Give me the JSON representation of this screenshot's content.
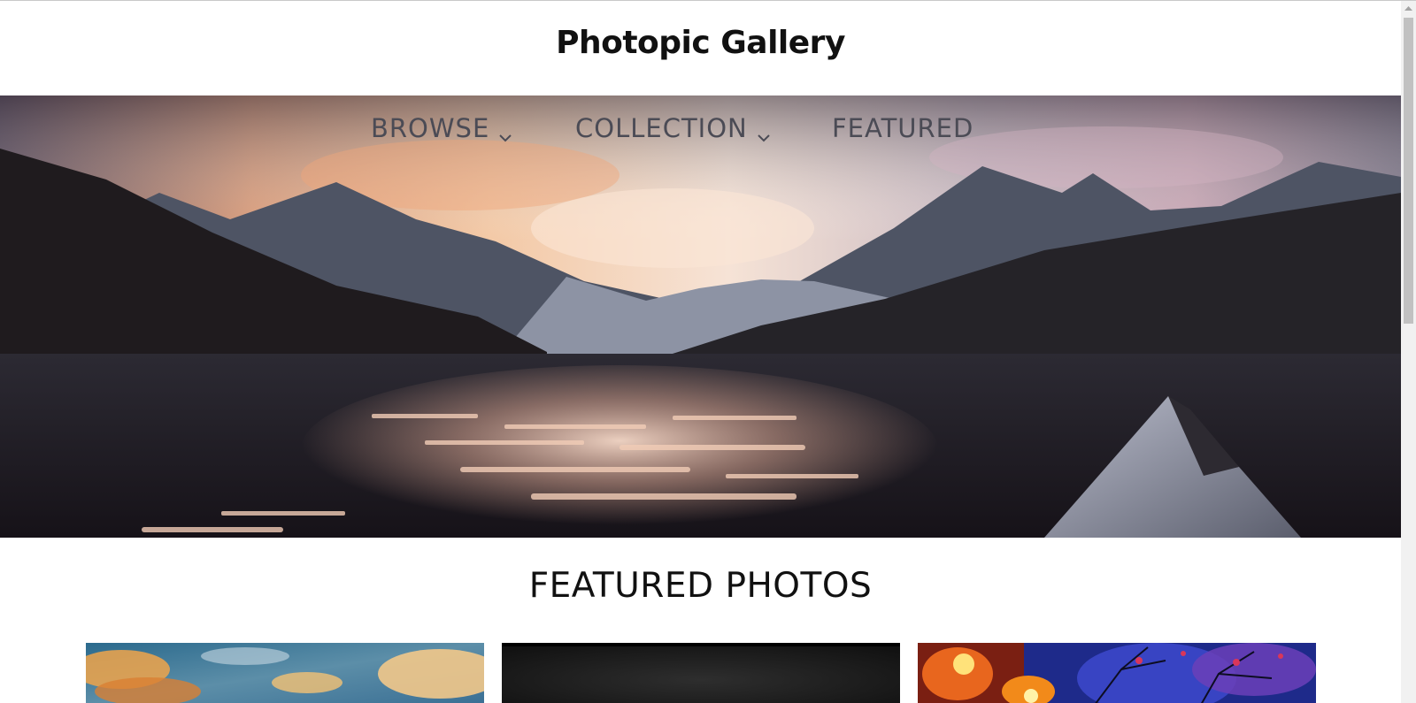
{
  "site": {
    "title": "Photopic Gallery"
  },
  "nav": {
    "items": [
      {
        "label": "BROWSE",
        "has_dropdown": true,
        "icon": "chevron-down-icon"
      },
      {
        "label": "COLLECTION",
        "has_dropdown": true,
        "icon": "chevron-down-icon"
      },
      {
        "label": "FEATURED",
        "has_dropdown": false
      }
    ]
  },
  "hero": {
    "image": "mountain-lake-sunset"
  },
  "featured": {
    "title": "FEATURED PHOTOS",
    "photos": [
      {
        "image": "sunset-clouds-painting"
      },
      {
        "image": "dark-gradient"
      },
      {
        "image": "autumn-street-painting"
      }
    ]
  },
  "colors": {
    "text": "#111111",
    "nav_text": "#4b4b55",
    "scrollbar_thumb": "#c1c1c1"
  }
}
